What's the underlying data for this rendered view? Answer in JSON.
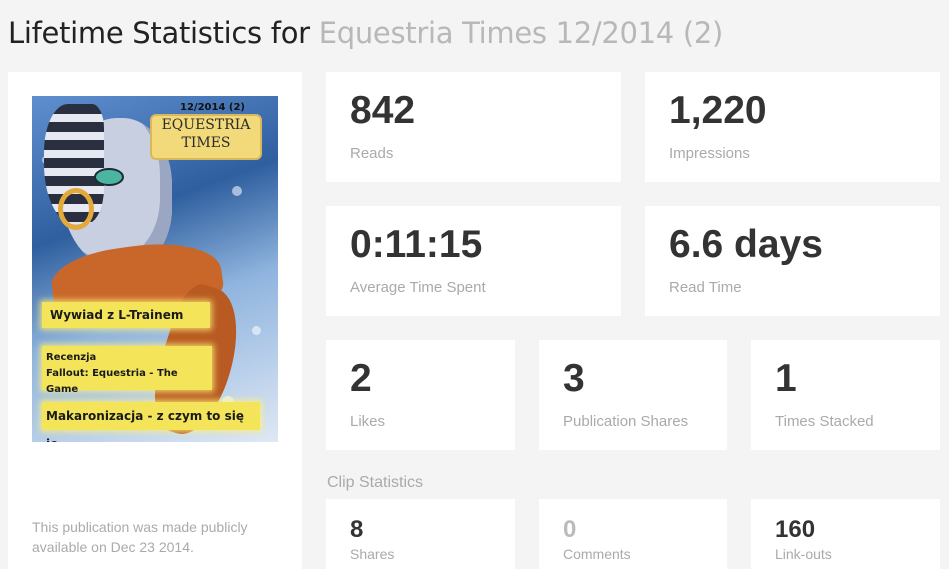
{
  "header": {
    "prefix": "Lifetime Statistics for",
    "publication": "Equestria Times 12/2014 (2)"
  },
  "cover": {
    "issue": "12/2014 (2)",
    "masthead_line1": "EQUESTRIA",
    "masthead_line2": "TIMES",
    "headline1": "Wywiad z L-Trainem",
    "headline2_line1": "Recenzja",
    "headline2_line2": "Fallout: Equestria - The Game",
    "headline3": "Makaronizacja - z czym to się je",
    "note": "This publication was made publicly available on Dec 23 2014."
  },
  "stats": {
    "reads": {
      "value": "842",
      "label": "Reads"
    },
    "impressions": {
      "value": "1,220",
      "label": "Impressions"
    },
    "avg_time": {
      "value": "0:11:15",
      "label": "Average Time Spent"
    },
    "read_time": {
      "value": "6.6 days",
      "label": "Read Time"
    },
    "likes": {
      "value": "2",
      "label": "Likes"
    },
    "publication_shares": {
      "value": "3",
      "label": "Publication Shares"
    },
    "times_stacked": {
      "value": "1",
      "label": "Times Stacked"
    }
  },
  "clip_statistics": {
    "title": "Clip Statistics",
    "shares": {
      "value": "8",
      "label": "Shares"
    },
    "comments": {
      "value": "0",
      "label": "Comments"
    },
    "linkouts": {
      "value": "160",
      "label": "Link-outs"
    }
  },
  "colors": {
    "background": "#f4f4f4",
    "card": "#ffffff",
    "value_text": "#333333",
    "muted_text": "#aaaaaa"
  }
}
